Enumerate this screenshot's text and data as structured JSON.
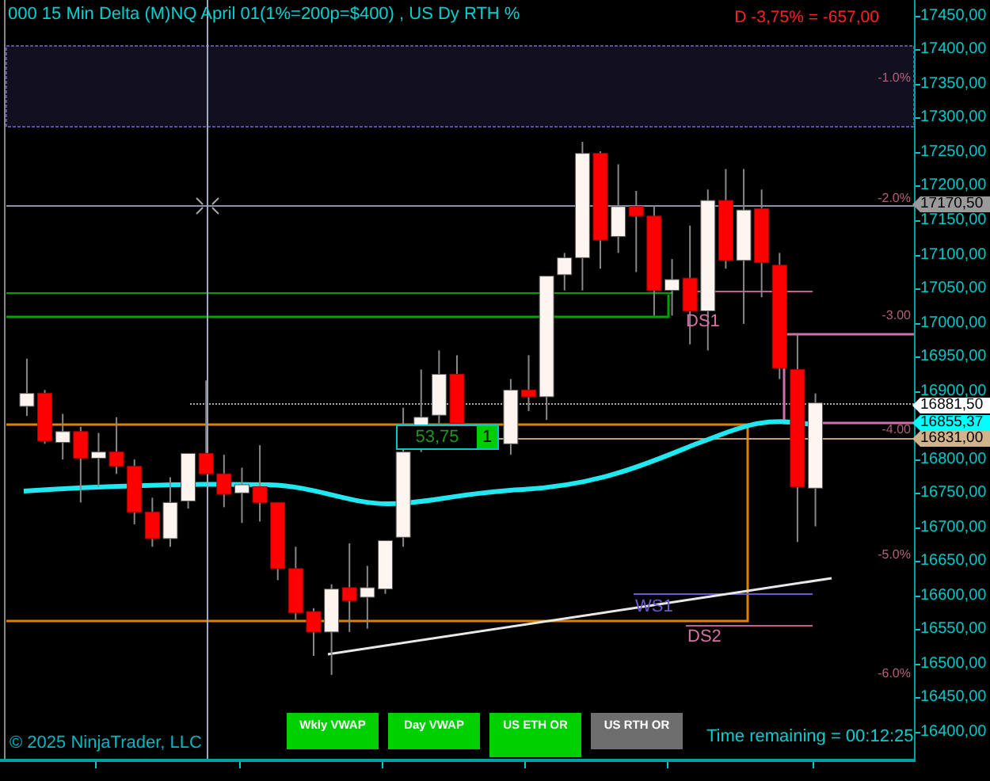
{
  "title": "000 15 Min Delta (M)NQ  April 01(1%=200p=$400) , US Dy RTH %",
  "pnl": "D -3,75% = -657,00",
  "price_tags": [
    {
      "text": "17170,50",
      "color": "#9a9a9a"
    },
    {
      "text": "16881,50",
      "color": "#ffffff"
    },
    {
      "text": "16855,37",
      "color": "#00ffff"
    },
    {
      "text": "16831,00",
      "color": "#d2b48c"
    }
  ],
  "chart_data": {
    "type": "candlestick",
    "categories": [
      null,
      null,
      null,
      null,
      null,
      null,
      null,
      null,
      null,
      null,
      null,
      null,
      null,
      null,
      null,
      null,
      null,
      null,
      null,
      null,
      null,
      null,
      null,
      null,
      null,
      null,
      null,
      null,
      null,
      null,
      null,
      null,
      null,
      null,
      null,
      null,
      null,
      null,
      null,
      null,
      null,
      null,
      null,
      null,
      null,
      null,
      null,
      null,
      null,
      null,
      null
    ],
    "ylim": [
      16360,
      17473
    ],
    "yticks": [
      {
        "value": 17450,
        "label": "17450,00"
      },
      {
        "value": 17400,
        "label": "17400,00"
      },
      {
        "value": 17350,
        "label": "17350,00"
      },
      {
        "value": 17300,
        "label": "17300,00"
      },
      {
        "value": 17250,
        "label": "17250,00"
      },
      {
        "value": 17200,
        "label": "17200,00"
      },
      {
        "value": 17150,
        "label": "17150,00"
      },
      {
        "value": 17100,
        "label": "17100,00"
      },
      {
        "value": 17050,
        "label": "17050,00"
      },
      {
        "value": 17000,
        "label": "17000,00"
      },
      {
        "value": 16950,
        "label": "16950,00"
      },
      {
        "value": 16900,
        "label": "16900,00"
      },
      {
        "value": 16800,
        "label": "16800,00"
      },
      {
        "value": 16750,
        "label": "16750,00"
      },
      {
        "value": 16700,
        "label": "16700,00"
      },
      {
        "value": 16650,
        "label": "16650,00"
      },
      {
        "value": 16600,
        "label": "16600,00"
      },
      {
        "value": 16550,
        "label": "16550,00"
      },
      {
        "value": 16500,
        "label": "16500,00"
      },
      {
        "value": 16450,
        "label": "16450,00"
      },
      {
        "value": 16400,
        "label": "16400,00"
      }
    ],
    "ohlc": [
      null,
      [
        16877,
        16947,
        16863,
        16896
      ],
      [
        16896,
        16901,
        16822,
        16826
      ],
      [
        16824,
        16866,
        16799,
        16840
      ],
      [
        16840,
        16847,
        16736,
        16801
      ],
      [
        16801,
        16838,
        16759,
        16810
      ],
      [
        16810,
        16861,
        16778,
        16789
      ],
      [
        16789,
        16799,
        16704,
        16722
      ],
      [
        16722,
        16743,
        16671,
        16683
      ],
      [
        16683,
        16773,
        16671,
        16736
      ],
      [
        16738,
        16808,
        16727,
        16808
      ],
      [
        16808,
        16915,
        16778,
        16778
      ],
      [
        16778,
        16806,
        16729,
        16748
      ],
      [
        16750,
        16787,
        16706,
        16762
      ],
      [
        16759,
        16820,
        16708,
        16736
      ],
      [
        16736,
        16736,
        16622,
        16639
      ],
      [
        16639,
        16671,
        16564,
        16574
      ],
      [
        16576,
        16581,
        16511,
        16546
      ],
      [
        16546,
        16616,
        16483,
        16609
      ],
      [
        16611,
        16676,
        16546,
        16592
      ],
      [
        16597,
        16643,
        16551,
        16611
      ],
      [
        16609,
        16680,
        16602,
        16680
      ],
      [
        16685,
        16875,
        16671,
        16810
      ],
      [
        16817,
        16931,
        16810,
        16861
      ],
      [
        16864,
        16959,
        16852,
        16924
      ],
      [
        16924,
        16952,
        16852,
        16852
      ],
      null,
      null,
      [
        16822,
        16917,
        16806,
        16901
      ],
      [
        16901,
        16952,
        16870,
        16891
      ],
      [
        16891,
        17068,
        16857,
        17068
      ],
      [
        17070,
        17102,
        17047,
        17095
      ],
      [
        17095,
        17265,
        17047,
        17248
      ],
      [
        17248,
        17251,
        17079,
        17121
      ],
      [
        17126,
        17232,
        17102,
        17170
      ],
      [
        17170,
        17193,
        17074,
        17156
      ],
      [
        17156,
        17172,
        17010,
        17047
      ],
      [
        17047,
        17093,
        17010,
        17063
      ],
      [
        17065,
        17142,
        16968,
        17017
      ],
      [
        17017,
        17195,
        16959,
        17179
      ],
      [
        17179,
        17225,
        17079,
        17091
      ],
      [
        17091,
        17225,
        16998,
        17165
      ],
      [
        17167,
        17195,
        17037,
        17088
      ],
      [
        17084,
        17102,
        16917,
        16933
      ],
      [
        16931,
        16982,
        16678,
        16759
      ],
      [
        16757,
        16896,
        16701,
        16882
      ],
      null,
      null,
      null,
      null,
      null
    ]
  },
  "percent_labels": [
    "-1.0%",
    "-2.0%",
    "-3.00",
    "-4.00",
    "-5.0%",
    "-6.0%"
  ],
  "level_labels": [
    {
      "text": "DS1",
      "color": "#d870a8"
    },
    {
      "text": "WS1",
      "color": "#6a5acd"
    },
    {
      "text": "DS2",
      "color": "#d870a8"
    }
  ],
  "position_marker": {
    "value": "53,75",
    "quantity": "1"
  },
  "buttons": [
    {
      "label": "Wkly VWAP",
      "on": true
    },
    {
      "label": "Day VWAP",
      "on": true
    },
    {
      "label": "US ETH OR",
      "on": true
    },
    {
      "label": "US RTH OR",
      "on": false
    }
  ],
  "copyright": "© 2025 NinjaTrader, LLC",
  "time_remaining": "Time remaining = 00:12:25"
}
